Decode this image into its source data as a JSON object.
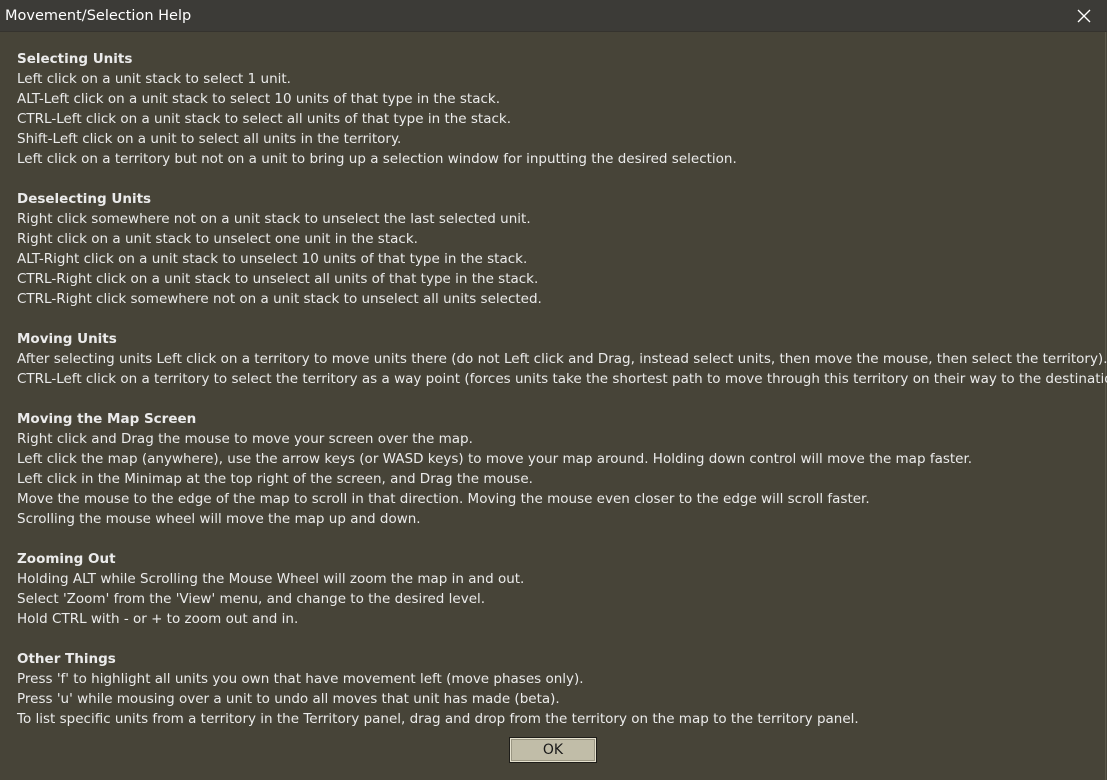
{
  "window": {
    "title": "Movement/Selection Help",
    "ok_label": "OK"
  },
  "sections": [
    {
      "heading": "Selecting Units",
      "lines": [
        "Left click on a unit stack to select 1 unit.",
        "ALT-Left click on a unit stack to select 10 units of that type in the stack.",
        "CTRL-Left click on a unit stack to select all units of that type in the stack.",
        "Shift-Left click on a unit to select all units in the territory.",
        "Left click on a territory but not on a unit to bring up a selection window for inputting the desired selection."
      ]
    },
    {
      "heading": "Deselecting Units",
      "lines": [
        "Right click somewhere not on a unit stack to unselect the last selected unit.",
        "Right click on a unit stack to unselect one unit in the stack.",
        "ALT-Right click on a unit stack to unselect 10 units of that type in the stack.",
        "CTRL-Right click on a unit stack to unselect all units of that type in the stack.",
        "CTRL-Right click somewhere not on a unit stack to unselect all units selected."
      ]
    },
    {
      "heading": "Moving Units",
      "lines": [
        "After selecting units Left click on a territory to move units there (do not Left click and Drag, instead select units, then move the mouse, then select the territory).",
        "CTRL-Left click on a territory to select the territory as a way point (forces units take the shortest path to move through this territory on their way to the destination)."
      ]
    },
    {
      "heading": "Moving the Map Screen",
      "lines": [
        "Right click and Drag the mouse to move your screen over the map.",
        "Left click the map (anywhere), use the arrow keys (or WASD keys) to move your map around. Holding down control will move the map faster.",
        "Left click in the Minimap at the top right of the screen, and Drag the mouse.",
        "Move the mouse to the edge of the map to scroll in that direction. Moving the mouse even closer to the edge will scroll faster.",
        "Scrolling the mouse wheel will move the map up and down."
      ]
    },
    {
      "heading": "Zooming Out",
      "lines": [
        "Holding ALT while Scrolling the Mouse Wheel will zoom the map in and out.",
        "Select 'Zoom' from the 'View' menu, and change to the desired level.",
        "Hold CTRL with - or + to zoom out and in."
      ]
    },
    {
      "heading": "Other Things",
      "lines": [
        "Press 'f' to highlight all units you own that have movement left (move phases only).",
        "Press 'u' while mousing over a unit to undo all moves that unit has made (beta).",
        "To list specific units from a territory in the Territory panel, drag and drop from the territory on the map to the territory panel."
      ]
    }
  ]
}
